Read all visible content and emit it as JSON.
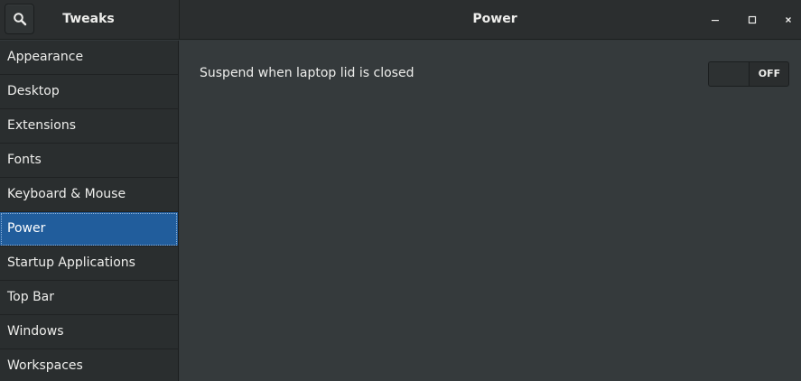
{
  "header": {
    "app_title": "Tweaks",
    "page_title": "Power",
    "search_icon": "search-icon",
    "window_controls": [
      "minimize-icon",
      "maximize-icon",
      "close-icon"
    ]
  },
  "sidebar": {
    "items": [
      {
        "label": "Appearance"
      },
      {
        "label": "Desktop"
      },
      {
        "label": "Extensions"
      },
      {
        "label": "Fonts"
      },
      {
        "label": "Keyboard & Mouse"
      },
      {
        "label": "Power",
        "selected": true
      },
      {
        "label": "Startup Applications"
      },
      {
        "label": "Top Bar"
      },
      {
        "label": "Windows"
      },
      {
        "label": "Workspaces"
      }
    ]
  },
  "main": {
    "settings": [
      {
        "label": "Suspend when laptop lid is closed",
        "switch_state": "OFF"
      }
    ]
  },
  "colors": {
    "selection": "#215d9c",
    "sidebar_bg": "#2a2e2f",
    "content_bg": "#353a3c",
    "headerbar_bg": "#2b2e2f"
  }
}
